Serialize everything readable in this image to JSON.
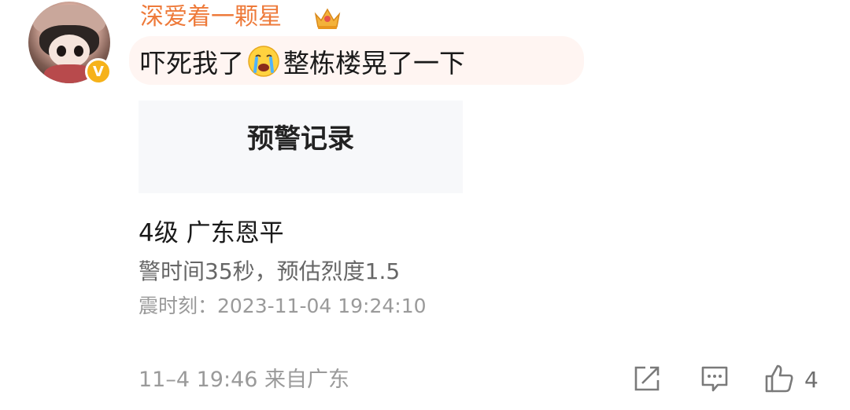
{
  "comment": {
    "username": "深爱着一颗星",
    "text_before": "吓死我了",
    "emoji": "crying-face-icon",
    "text_after": "整栋楼晃了一下",
    "user_badge": "V"
  },
  "card": {
    "title": "预警记录"
  },
  "earthquake": {
    "title": "4级 广东恩平",
    "info": "警时间35秒，预估烈度1.5",
    "time": "震时刻：2023-11-04 19:24:10"
  },
  "footer": {
    "meta": "11–4 19:46  来自广东",
    "like_count": "4"
  },
  "colors": {
    "username": "#ee7a3a",
    "badge": "#f6b21a",
    "bubble": "#fff5f2",
    "card_bg": "#f7f8fa"
  }
}
